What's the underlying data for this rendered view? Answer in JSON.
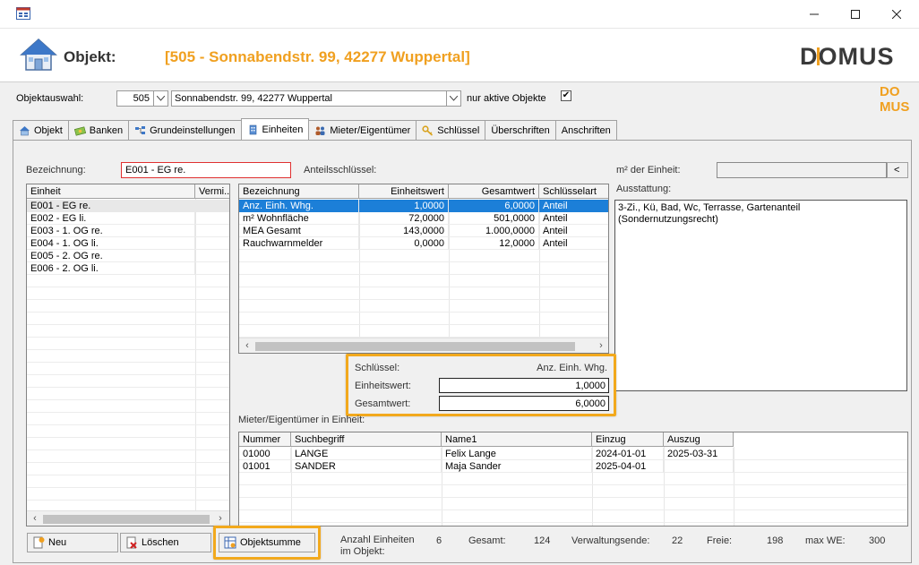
{
  "header": {
    "label": "Objekt:",
    "title": "[505 - Sonnabendstr. 99, 42277 Wuppertal]",
    "logo": "DOMUS"
  },
  "selection": {
    "label": "Objektauswahl:",
    "number": "505",
    "address": "Sonnabendstr. 99, 42277 Wuppertal",
    "active_label": "nur aktive Objekte",
    "active_checked": "✔"
  },
  "tabs": [
    {
      "label": "Objekt",
      "icon": "house-icon"
    },
    {
      "label": "Banken",
      "icon": "money-icon"
    },
    {
      "label": "Grundeinstellungen",
      "icon": "settings-tree-icon"
    },
    {
      "label": "Einheiten",
      "icon": "building-icon"
    },
    {
      "label": "Mieter/Eigentümer",
      "icon": "people-icon"
    },
    {
      "label": "Schlüssel",
      "icon": "key-icon"
    },
    {
      "label": "Überschriften",
      "icon": ""
    },
    {
      "label": "Anschriften",
      "icon": ""
    }
  ],
  "form": {
    "bezeichnung_label": "Bezeichnung:",
    "bezeichnung_value": "E001 - EG re.",
    "anteils_label": "Anteilsschlüssel:",
    "m2_label": "m² der Einheit:",
    "m2_value": "",
    "m2_button": "<",
    "ausstattung_label": "Ausstattung:",
    "ausstattung_value": "3-Zi., Kü, Bad, Wc, Terrasse, Gartenanteil\n(Sondernutzungsrecht)"
  },
  "units_grid": {
    "columns": [
      "Einheit",
      "Vermi.."
    ],
    "rows": [
      "E001 - EG re.",
      "E002 - EG li.",
      "E003 - 1. OG re.",
      "E004 - 1. OG li.",
      "E005 - 2. OG re.",
      "E006 - 2. OG li."
    ]
  },
  "keys_grid": {
    "columns": [
      "Bezeichnung",
      "Einheitswert",
      "Gesamtwert",
      "Schlüsselart"
    ],
    "rows": [
      [
        "Anz. Einh. Whg.",
        "1,0000",
        "6,0000",
        "Anteil"
      ],
      [
        "m² Wohnfläche",
        "72,0000",
        "501,0000",
        "Anteil"
      ],
      [
        "MEA Gesamt",
        "143,0000",
        "1.000,0000",
        "Anteil"
      ],
      [
        "Rauchwarnmelder",
        "0,0000",
        "12,0000",
        "Anteil"
      ]
    ]
  },
  "key_detail": {
    "schluessel_label": "Schlüssel:",
    "schluessel_value": "Anz. Einh. Whg.",
    "einheitswert_label": "Einheitswert:",
    "einheitswert_value": "1,0000",
    "gesamtwert_label": "Gesamtwert:",
    "gesamtwert_value": "6,0000"
  },
  "tenants": {
    "label": "Mieter/Eigentümer in Einheit:",
    "columns": [
      "Nummer",
      "Suchbegriff",
      "Name1",
      "Einzug",
      "Auszug"
    ],
    "rows": [
      [
        "01000",
        "LANGE",
        "Felix Lange",
        "2024-01-01",
        "2025-03-31"
      ],
      [
        "01001",
        "SANDER",
        "Maja Sander",
        "2025-04-01",
        ""
      ]
    ]
  },
  "buttons": {
    "neu": "Neu",
    "loeschen": "Löschen",
    "objektsumme": "Objektsumme"
  },
  "stats": {
    "anzahl_label_1": "Anzahl Einheiten",
    "anzahl_label_2": "im Objekt:",
    "anzahl_value": "6",
    "gesamt_label": "Gesamt:",
    "gesamt_value": "124",
    "verwaltungsende_label": "Verwaltungsende:",
    "verwaltungsende_value": "22",
    "freie_label": "Freie:",
    "freie_value": "198",
    "maxwe_label": "max WE:",
    "maxwe_value": "300"
  },
  "colors": {
    "accent_orange": "#f2a91d",
    "title_orange": "#f0a020",
    "selection_blue": "#1c7fd8"
  }
}
